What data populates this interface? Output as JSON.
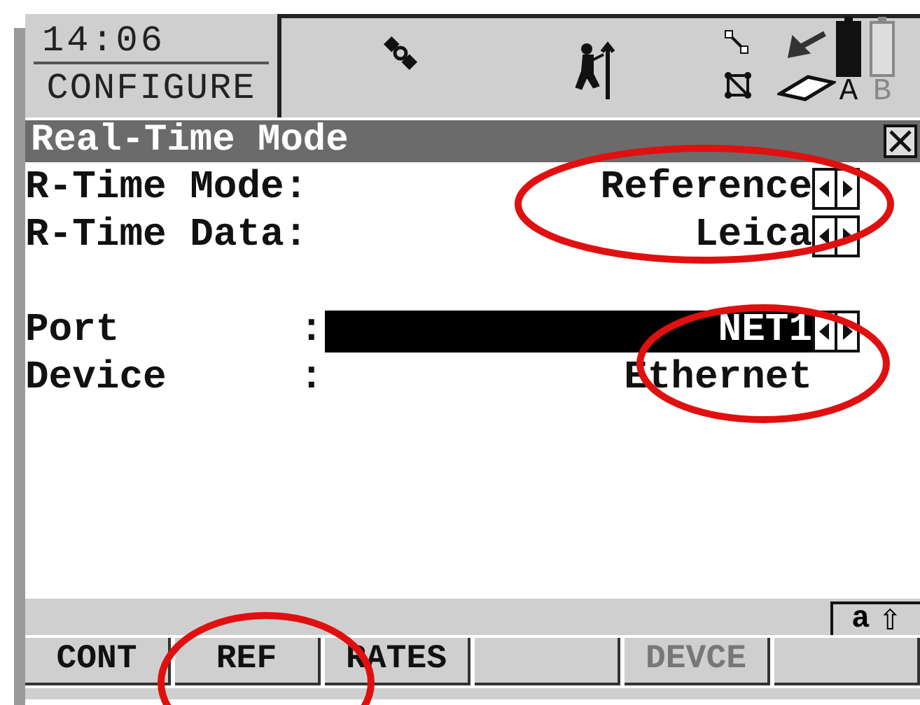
{
  "status": {
    "time": "14:06",
    "mode": "CONFIGURE",
    "battery_a": {
      "label": "A",
      "level": 1.0
    },
    "battery_b": {
      "label": "B",
      "level": 0
    }
  },
  "dialog": {
    "title": "Real-Time Mode",
    "fields": [
      {
        "kind": "choice",
        "label": "R-Time Mode:",
        "value": "Reference",
        "selected": false
      },
      {
        "kind": "choice",
        "label": "R-Time Data:",
        "value": "Leica",
        "selected": false
      },
      {
        "kind": "gap"
      },
      {
        "kind": "choice",
        "label": "Port",
        "colon": ":",
        "value": "NET1",
        "selected": true
      },
      {
        "kind": "display",
        "label": "Device",
        "colon": ":",
        "value": "Ethernet",
        "selected": false
      }
    ]
  },
  "input_mode": {
    "case": "a",
    "shift": "⇧"
  },
  "softkeys": [
    {
      "kind": "key",
      "label": "CONT",
      "disabled": false
    },
    {
      "kind": "key",
      "label": "REF",
      "disabled": false
    },
    {
      "kind": "key",
      "label": "RATES",
      "disabled": false
    },
    {
      "kind": "empty"
    },
    {
      "kind": "key",
      "label": "DEVCE",
      "disabled": true
    },
    {
      "kind": "empty"
    }
  ]
}
